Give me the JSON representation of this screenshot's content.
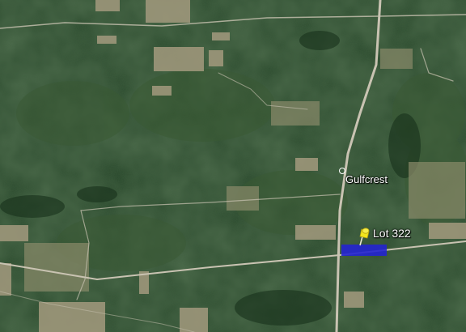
{
  "map": {
    "type": "satellite",
    "place_label": "Gulfcrest",
    "lot_label": "Lot 322",
    "colors": {
      "forest_dark": "#1c361c",
      "forest_mid": "#2c4d2b",
      "clearing": "#a39a7e",
      "road": "#c9c3b2",
      "parcel_fill": "#2424d2",
      "pin": "#f2e61c",
      "label_text": "#ffffff"
    },
    "icons": [
      "place-marker-icon",
      "pushpin-icon"
    ]
  }
}
